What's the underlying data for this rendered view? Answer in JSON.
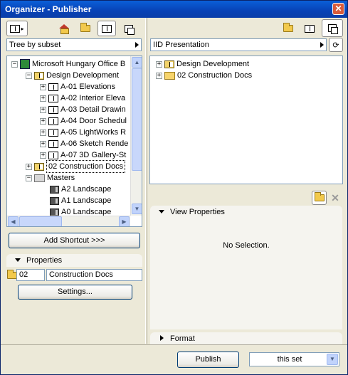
{
  "window": {
    "title": "Organizer - Publisher",
    "close_glyph": "✕"
  },
  "left": {
    "toolbar_icons": [
      "layout-arrow-icon",
      "project-map-icon",
      "view-map-icon",
      "layout-book-icon",
      "publisher-sets-icon"
    ],
    "tree_mode": "Tree by subset",
    "tree": {
      "root": "Microsoft Hungary Office B",
      "design_development": "Design Development",
      "items": [
        "A-01 Elevations",
        "A-02 Interior Eleva",
        "A-03 Detail Drawin",
        "A-04 Door Schedul",
        "A-05 LightWorks R",
        "A-06 Sketch Rende",
        "A-07 3D Gallery-St"
      ],
      "construction_docs": "02 Construction Docs",
      "masters": "Masters",
      "master_items": [
        "A2 Landscape",
        "A1 Landscape",
        "A0 Landscape"
      ]
    },
    "add_shortcut": "Add Shortcut >>>",
    "properties_label": "Properties",
    "id_value": "02",
    "name_value": "Construction Docs",
    "settings": "Settings..."
  },
  "right": {
    "toolbar_icons": [
      "folder-icon",
      "layout-icon",
      "publisher-sets-icon"
    ],
    "set_name": "IID Presentation",
    "tree": [
      "Design Development",
      "02 Construction Docs"
    ],
    "view_properties": "View Properties",
    "no_selection": "No Selection.",
    "format": "Format"
  },
  "footer": {
    "publish": "Publish",
    "scope": "this set"
  }
}
